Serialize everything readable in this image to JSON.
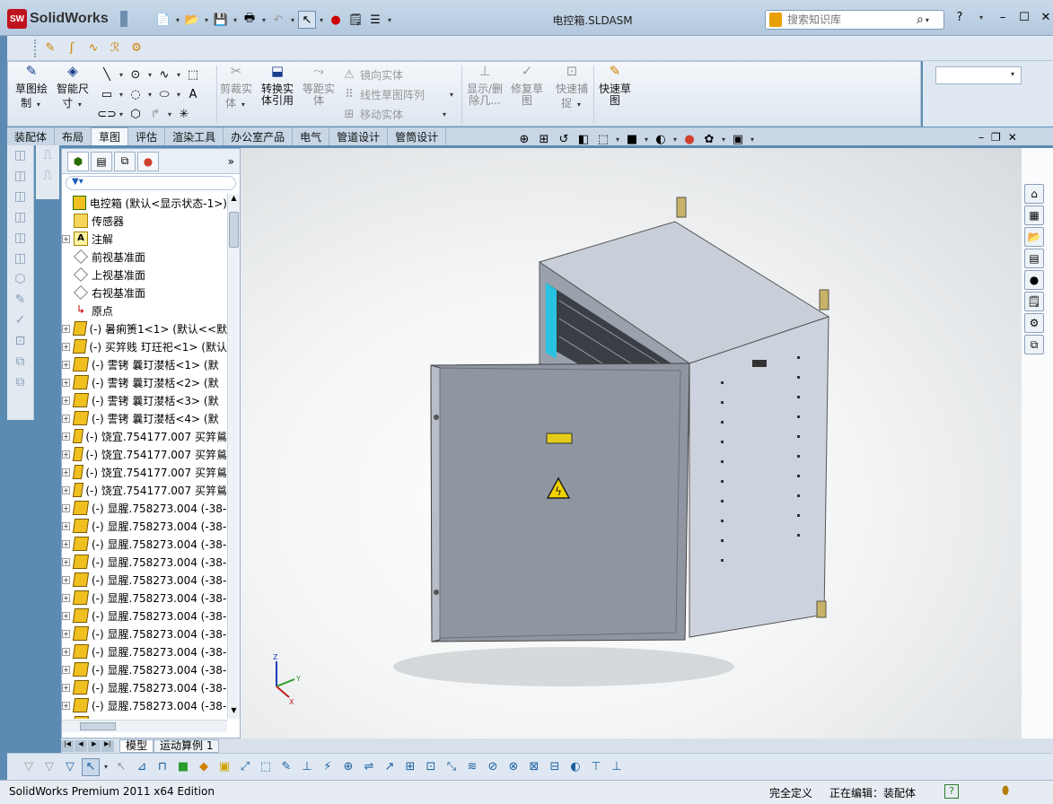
{
  "app": {
    "name": "SolidWorks",
    "badge": "SW",
    "document_title": "电控箱.SLDASM"
  },
  "search": {
    "placeholder": "搜索知识库"
  },
  "cmdmgr": {
    "sketch": "草图绘制",
    "smart_dimension": "智能尺寸",
    "trim": "剪裁实体",
    "convert": "转换实体引用",
    "offset": "等距实体",
    "mirror": "镜向实体",
    "linear_pattern": "线性草图阵列",
    "move": "移动实体",
    "show_delete": "显示/删除几...",
    "repair": "修复草图",
    "snaps": "快速捕捉",
    "rapid_sketch": "快速草图"
  },
  "cm_tabs": [
    "装配体",
    "布局",
    "草图",
    "评估",
    "渲染工具",
    "办公室产品",
    "电气",
    "管道设计",
    "管筒设计"
  ],
  "cm_active_tab": "草图",
  "tree": {
    "root": "电控箱 (默认<显示状态-1>)",
    "items": [
      {
        "label": "传感器",
        "icon": "folder",
        "exp": false
      },
      {
        "label": "注解",
        "icon": "note",
        "exp": true
      },
      {
        "label": "前视基准面",
        "icon": "plane",
        "exp": false
      },
      {
        "label": "上视基准面",
        "icon": "plane",
        "exp": false
      },
      {
        "label": "右视基准面",
        "icon": "plane",
        "exp": false
      },
      {
        "label": "原点",
        "icon": "origin",
        "exp": false
      },
      {
        "label": "(-) 暑痢箦1<1> (默认<<默",
        "icon": "part",
        "exp": true
      },
      {
        "label": "(-) 买笄贱 玎玨祀<1> (默认",
        "icon": "part",
        "exp": true
      },
      {
        "label": "(-) 霅铐    曩玎漤栝<1> (默",
        "icon": "part",
        "exp": true
      },
      {
        "label": "(-) 霅铐    曩玎漤栝<2> (默",
        "icon": "part",
        "exp": true
      },
      {
        "label": "(-) 霅铐    曩玎漤栝<3> (默",
        "icon": "part",
        "exp": true
      },
      {
        "label": "(-) 霅铐    曩玎漤栝<4> (默",
        "icon": "part",
        "exp": true
      },
      {
        "label": "(-) 饶宜.754177.007 买笄鶑",
        "icon": "part",
        "exp": true
      },
      {
        "label": "(-) 饶宜.754177.007 买笄鶑",
        "icon": "part",
        "exp": true
      },
      {
        "label": "(-) 饶宜.754177.007 买笄鶑",
        "icon": "part",
        "exp": true
      },
      {
        "label": "(-) 饶宜.754177.007 买笄鶑",
        "icon": "part",
        "exp": true
      },
      {
        "label": "(-) 显腥.758273.004 (-38-",
        "icon": "part",
        "exp": true
      },
      {
        "label": "(-) 显腥.758273.004 (-38-",
        "icon": "part",
        "exp": true
      },
      {
        "label": "(-) 显腥.758273.004 (-38-",
        "icon": "part",
        "exp": true
      },
      {
        "label": "(-) 显腥.758273.004 (-38-",
        "icon": "part",
        "exp": true
      },
      {
        "label": "(-) 显腥.758273.004 (-38-",
        "icon": "part",
        "exp": true
      },
      {
        "label": "(-) 显腥.758273.004 (-38-",
        "icon": "part",
        "exp": true
      },
      {
        "label": "(-) 显腥.758273.004 (-38-",
        "icon": "part",
        "exp": true
      },
      {
        "label": "(-) 显腥.758273.004 (-38-",
        "icon": "part",
        "exp": true
      },
      {
        "label": "(-) 显腥.758273.004 (-38-",
        "icon": "part",
        "exp": true
      },
      {
        "label": "(-) 显腥.758273.004 (-38-",
        "icon": "part",
        "exp": true
      },
      {
        "label": "(-) 显腥.758273.004 (-38-",
        "icon": "part",
        "exp": true
      },
      {
        "label": "(-) 显腥.758273.004 (-38-",
        "icon": "part",
        "exp": true
      },
      {
        "label": "(-) 显腥.758273.004 (-38-",
        "icon": "part",
        "exp": true
      }
    ]
  },
  "bottom_tabs": [
    "模型",
    "运动算例 1"
  ],
  "bottom_active_tab": "模型",
  "status": {
    "edition": "SolidWorks Premium 2011 x64 Edition",
    "definition": "完全定义",
    "editing": "正在编辑：装配体",
    "help": "?"
  },
  "triad": {
    "x": "X",
    "y": "Y",
    "z": "Z"
  },
  "colors": {
    "accent": "#c1121f",
    "title_bar": "#c9d9ea",
    "cabinet": "#c4cbd6"
  }
}
